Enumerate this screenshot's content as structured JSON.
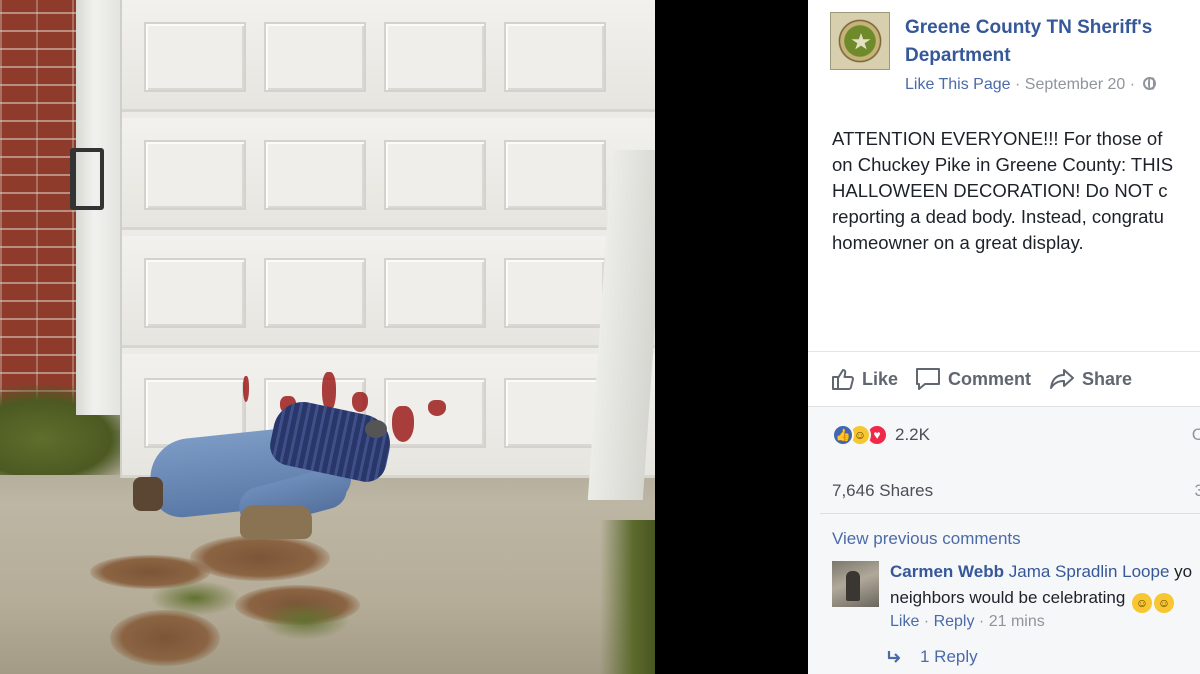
{
  "post": {
    "page_name": "Greene County TN Sheriff's Department",
    "like_page": "Like This Page",
    "dot": "·",
    "date": "September 20",
    "text_lines": [
      "ATTENTION EVERYONE!!! For those of",
      "on Chuckey Pike in Greene County: THIS",
      "HALLOWEEN DECORATION! Do NOT c",
      "reporting a dead body. Instead, congratu",
      "homeowner on a great display."
    ],
    "icons": {
      "privacy": "globe-icon",
      "like": "thumbs-up-icon",
      "comment": "speech-bubble-icon",
      "share": "share-arrow-icon",
      "reply": "reply-arrow-icon"
    }
  },
  "actions": {
    "like": "Like",
    "comment": "Comment",
    "share": "Share"
  },
  "feedback": {
    "reaction_count": "2.2K",
    "right_stub1": "C",
    "shares": "7,646 Shares",
    "right_stub2": "3",
    "view_previous": "View previous comments",
    "comment": {
      "author": "Carmen Webb",
      "mention": "Jama Spradlin Loope",
      "text_rest": " yo",
      "line2": "neighbors would be celebrating ",
      "like": "Like",
      "reply": "Reply",
      "sep": " · ",
      "time": "21 mins"
    },
    "replies": "1 Reply"
  },
  "colors": {
    "link_blue": "#365899",
    "meta_gray": "#90949c",
    "reaction_like": "#4267b2",
    "reaction_love": "#f0284a",
    "reaction_haha": "#f7c631"
  }
}
